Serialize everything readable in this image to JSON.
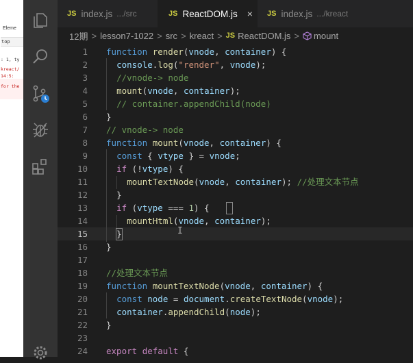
{
  "devtools": {
    "tab": "Eleme",
    "context": "top",
    "lines": [
      ": 1, ty",
      "kreact/",
      "14:5: ",
      "for the"
    ]
  },
  "activity_bar": {
    "icons": [
      "explorer-icon",
      "search-icon",
      "source-control-icon",
      "debug-icon",
      "extensions-icon",
      "settings-icon"
    ]
  },
  "tabs": [
    {
      "badge": "JS",
      "name": "index.js",
      "desc": ".../src",
      "active": false
    },
    {
      "badge": "JS",
      "name": "ReactDOM.js",
      "desc": "",
      "active": true,
      "close": "×"
    },
    {
      "badge": "JS",
      "name": "index.js",
      "desc": ".../kreact",
      "active": false
    }
  ],
  "breadcrumb": {
    "parts": [
      "12期",
      "lesson7-1022",
      "src",
      "kreact"
    ],
    "file_badge": "JS",
    "file": "ReactDOM.js",
    "symbol": "mount",
    "separator": ">"
  },
  "editor": {
    "current_line": 15,
    "lines": [
      {
        "n": "1",
        "tokens": [
          [
            "k",
            "function "
          ],
          [
            "f",
            "render"
          ],
          [
            "p",
            "("
          ],
          [
            "v",
            "vnode"
          ],
          [
            "p",
            ", "
          ],
          [
            "v",
            "container"
          ],
          [
            "p",
            ") {"
          ]
        ],
        "indent": 0
      },
      {
        "n": "2",
        "tokens": [
          [
            "v",
            "console"
          ],
          [
            "p",
            "."
          ],
          [
            "f",
            "log"
          ],
          [
            "p",
            "("
          ],
          [
            "s",
            "\"render\""
          ],
          [
            "p",
            ", "
          ],
          [
            "v",
            "vnode"
          ],
          [
            "p",
            ");"
          ]
        ],
        "indent": 1
      },
      {
        "n": "3",
        "tokens": [
          [
            "cm",
            "//vnode-> node"
          ]
        ],
        "indent": 1
      },
      {
        "n": "4",
        "tokens": [
          [
            "f",
            "mount"
          ],
          [
            "p",
            "("
          ],
          [
            "v",
            "vnode"
          ],
          [
            "p",
            ", "
          ],
          [
            "v",
            "container"
          ],
          [
            "p",
            ");"
          ]
        ],
        "indent": 1
      },
      {
        "n": "5",
        "tokens": [
          [
            "cm",
            "// container.appendChild(node)"
          ]
        ],
        "indent": 1
      },
      {
        "n": "6",
        "tokens": [
          [
            "p",
            "}"
          ]
        ],
        "indent": 0
      },
      {
        "n": "7",
        "tokens": [
          [
            "cm",
            "// vnode-> node"
          ]
        ],
        "indent": 0
      },
      {
        "n": "8",
        "tokens": [
          [
            "k",
            "function "
          ],
          [
            "f",
            "mount"
          ],
          [
            "p",
            "("
          ],
          [
            "v",
            "vnode"
          ],
          [
            "p",
            ", "
          ],
          [
            "v",
            "container"
          ],
          [
            "p",
            ") {"
          ]
        ],
        "indent": 0
      },
      {
        "n": "9",
        "tokens": [
          [
            "k",
            "const "
          ],
          [
            "p",
            "{ "
          ],
          [
            "v",
            "vtype"
          ],
          [
            "p",
            " } = "
          ],
          [
            "v",
            "vnode"
          ],
          [
            "p",
            ";"
          ]
        ],
        "indent": 1
      },
      {
        "n": "10",
        "tokens": [
          [
            "c",
            "if "
          ],
          [
            "p",
            "(!"
          ],
          [
            "v",
            "vtype"
          ],
          [
            "p",
            ") {"
          ]
        ],
        "indent": 1
      },
      {
        "n": "11",
        "tokens": [
          [
            "f",
            "mountTextNode"
          ],
          [
            "p",
            "("
          ],
          [
            "v",
            "vnode"
          ],
          [
            "p",
            ", "
          ],
          [
            "v",
            "container"
          ],
          [
            "p",
            "); "
          ],
          [
            "cm",
            "//处理文本节点"
          ]
        ],
        "indent": 2
      },
      {
        "n": "12",
        "tokens": [
          [
            "p",
            "}"
          ]
        ],
        "indent": 1
      },
      {
        "n": "13",
        "tokens": [
          [
            "c",
            "if "
          ],
          [
            "p",
            "("
          ],
          [
            "v",
            "vtype"
          ],
          [
            "p",
            " === "
          ],
          [
            "n",
            "1"
          ],
          [
            "p",
            ") {"
          ]
        ],
        "indent": 1
      },
      {
        "n": "14",
        "tokens": [
          [
            "f",
            "mountHtml"
          ],
          [
            "p",
            "("
          ],
          [
            "v",
            "vnode"
          ],
          [
            "p",
            ", "
          ],
          [
            "v",
            "container"
          ],
          [
            "p",
            ");"
          ]
        ],
        "indent": 2
      },
      {
        "n": "15",
        "tokens": [
          [
            "p",
            "}"
          ]
        ],
        "indent": 1
      },
      {
        "n": "16",
        "tokens": [
          [
            "p",
            "}"
          ]
        ],
        "indent": 0
      },
      {
        "n": "17",
        "tokens": [],
        "indent": 0
      },
      {
        "n": "18",
        "tokens": [
          [
            "cm",
            "//处理文本节点"
          ]
        ],
        "indent": 0
      },
      {
        "n": "19",
        "tokens": [
          [
            "k",
            "function "
          ],
          [
            "f",
            "mountTextNode"
          ],
          [
            "p",
            "("
          ],
          [
            "v",
            "vnode"
          ],
          [
            "p",
            ", "
          ],
          [
            "v",
            "container"
          ],
          [
            "p",
            ") {"
          ]
        ],
        "indent": 0
      },
      {
        "n": "20",
        "tokens": [
          [
            "k",
            "const "
          ],
          [
            "v",
            "node"
          ],
          [
            "p",
            " = "
          ],
          [
            "v",
            "document"
          ],
          [
            "p",
            "."
          ],
          [
            "f",
            "createTextNode"
          ],
          [
            "p",
            "("
          ],
          [
            "v",
            "vnode"
          ],
          [
            "p",
            ");"
          ]
        ],
        "indent": 1
      },
      {
        "n": "21",
        "tokens": [
          [
            "v",
            "container"
          ],
          [
            "p",
            "."
          ],
          [
            "f",
            "appendChild"
          ],
          [
            "p",
            "("
          ],
          [
            "v",
            "node"
          ],
          [
            "p",
            ");"
          ]
        ],
        "indent": 1
      },
      {
        "n": "22",
        "tokens": [
          [
            "p",
            "}"
          ]
        ],
        "indent": 0
      },
      {
        "n": "23",
        "tokens": [],
        "indent": 0
      },
      {
        "n": "24",
        "tokens": [
          [
            "c",
            "export "
          ],
          [
            "c",
            "default "
          ],
          [
            "p",
            "{"
          ]
        ],
        "indent": 0
      }
    ],
    "cursor_glyph": "I"
  },
  "colors": {
    "keyword": "#569cd6",
    "control": "#c586c0",
    "function": "#dcdcaa",
    "variable": "#9cdcfe",
    "string": "#ce9178",
    "number": "#b5cea8",
    "comment": "#6a9955",
    "js_badge": "#cbcb41"
  }
}
